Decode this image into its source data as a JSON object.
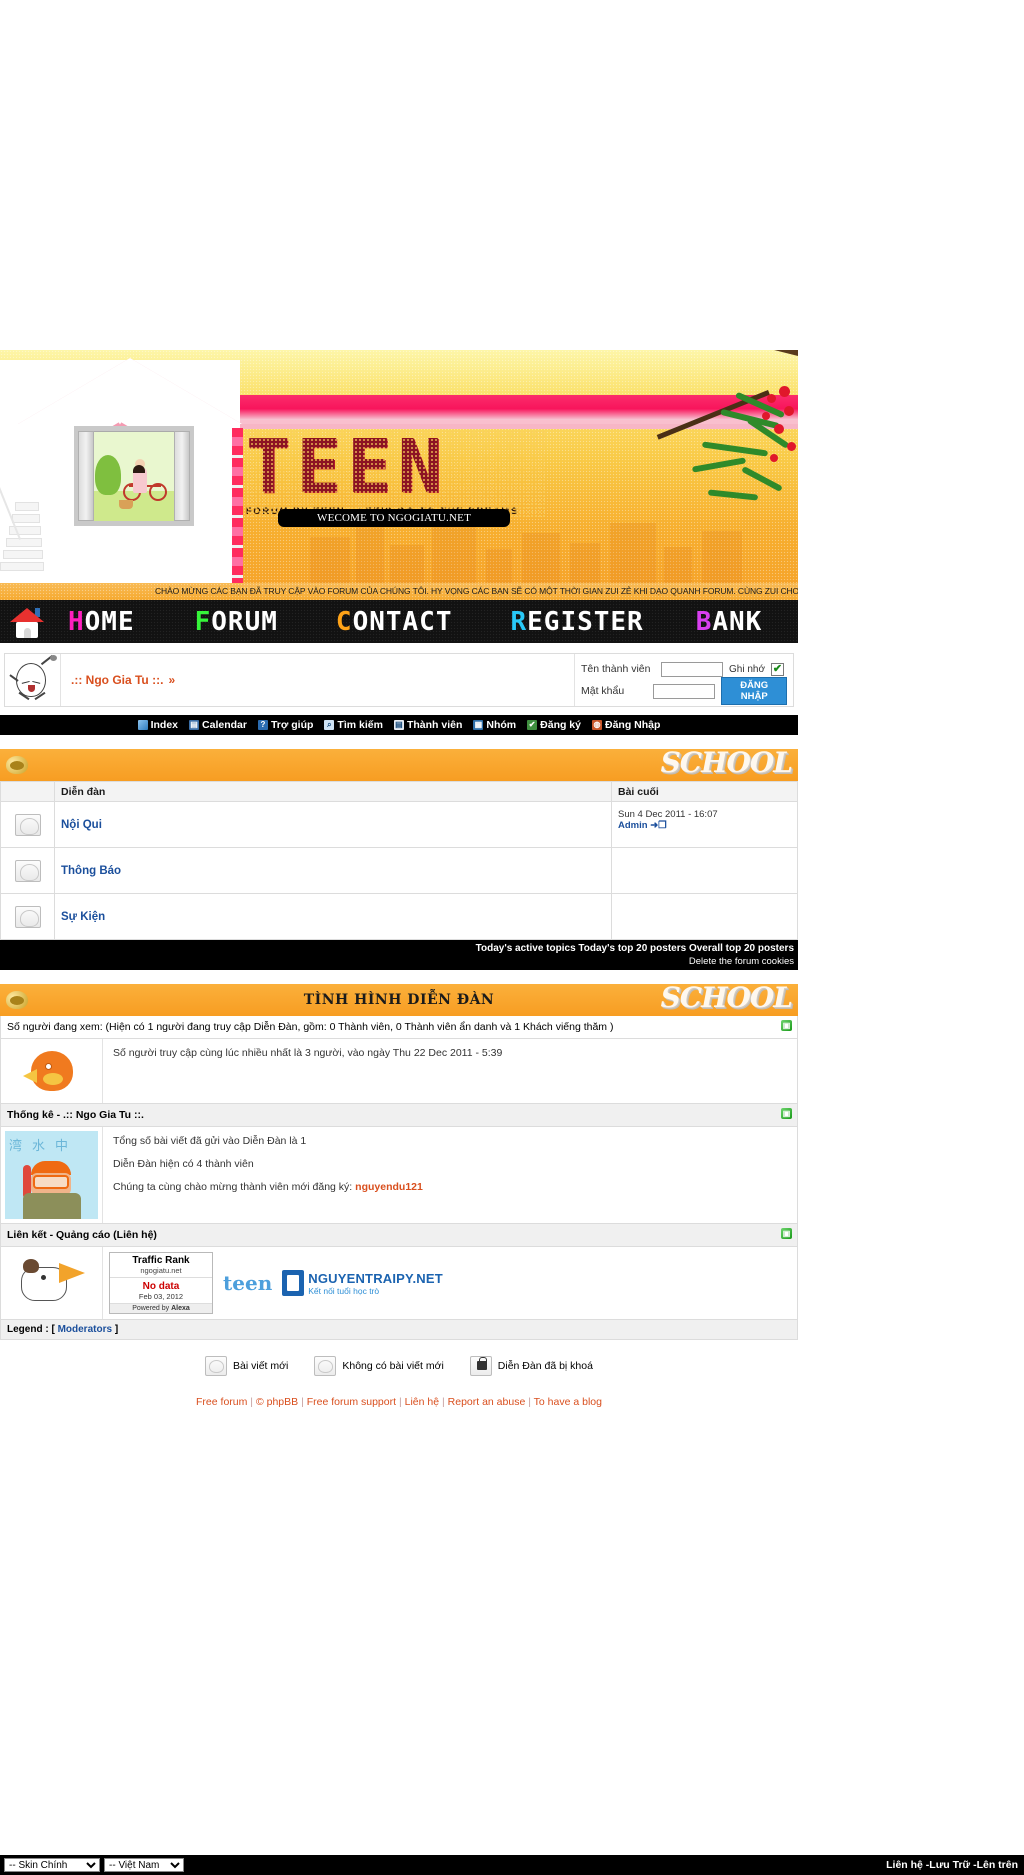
{
  "banner": {
    "logo_text": "TEEN",
    "logo_subtitle": "FORUM BY TEEN - LET'S GO TO THE DREAMS",
    "welcome_pill": "WECOME TO NGOGIATU.NET",
    "marquee": "CHÀO MỪNG CÁC BẠN ĐÃ TRUY CẬP VÀO FORUM CỦA CHÚNG TÔI. HY VỌNG CÁC BẠN SẼ CÓ MỘT THỜI GIAN ZUI ZẺ KHI DẠO QUANH FORUM. CÙNG ZUI CHƠI NHÉ. GOOD LUCK!"
  },
  "mainnav": {
    "home_icon": "house-icon",
    "items": [
      {
        "label": "HOME",
        "color": "#ff1fbf"
      },
      {
        "label": "FORUM",
        "color": "#36f53a"
      },
      {
        "label": "CONTACT",
        "color": "#ffa318"
      },
      {
        "label": "REGISTER",
        "color": "#29c8f7"
      },
      {
        "label": "BANK",
        "color": "#d93ff0"
      }
    ]
  },
  "userbar": {
    "avatar_icon": "egg-mascot-avatar",
    "site_title": ".:: Ngo Gia Tu ::.",
    "site_title_arrow": "»",
    "login": {
      "username_label": "Tên thành viên",
      "username_value": "",
      "password_label": "Mật khẩu",
      "password_value": "",
      "remember_label": "Ghi nhớ",
      "remember_checked": "✔",
      "submit_label": "ĐĂNG NHẬP"
    }
  },
  "subnav": {
    "items": [
      {
        "label": "Index",
        "icon": "index-icon",
        "icon_glyph": ""
      },
      {
        "label": "Calendar",
        "icon": "calendar-icon",
        "icon_glyph": "▤"
      },
      {
        "label": "Trợ giúp",
        "icon": "help-icon",
        "icon_glyph": "?"
      },
      {
        "label": "Tìm kiếm",
        "icon": "search-icon",
        "icon_glyph": "⌕"
      },
      {
        "label": "Thành viên",
        "icon": "members-icon",
        "icon_glyph": "▤"
      },
      {
        "label": "Nhóm",
        "icon": "groups-icon",
        "icon_glyph": "▦"
      },
      {
        "label": "Đăng ký",
        "icon": "register-icon",
        "icon_glyph": "✔"
      },
      {
        "label": "Đăng Nhập",
        "icon": "login-icon",
        "icon_glyph": "◍"
      }
    ]
  },
  "forum_table": {
    "header_watermark": "SCHOOL",
    "header_title": "",
    "columns": [
      "Diễn đàn",
      "Bài cuối"
    ],
    "rows": [
      {
        "icon": "forum-folder-icon",
        "name": "Nội Qui",
        "last_post_date": "Sun 4 Dec 2011 - 16:07",
        "last_post_author": "Admin",
        "last_post_jump": "➜❐"
      },
      {
        "icon": "forum-folder-icon",
        "name": "Thông Báo",
        "last_post_date": "",
        "last_post_author": "",
        "last_post_jump": ""
      },
      {
        "icon": "forum-folder-icon",
        "name": "Sự Kiện",
        "last_post_date": "",
        "last_post_author": "",
        "last_post_jump": ""
      }
    ],
    "footer_line1": "Today's active topics Today's top 20 posters Overall top 20 posters",
    "footer_line2": "Delete the forum cookies"
  },
  "stats": {
    "header_title": "TÌNH HÌNH DIỄN ĐÀN",
    "header_watermark": "SCHOOL",
    "viewing_line": "Số người đang xem: (Hiện có 1 người đang truy cập Diễn Đàn, gồm: 0 Thành viên, 0 Thành viên ẩn danh và 1 Khách viếng thăm )",
    "record_line": "Số người truy cập cùng lúc nhiều nhất là 3 người, vào ngày Thu 22 Dec 2011 - 5:39",
    "record_icon": "bird-mascot-icon",
    "stats_header": "Thống kê - .:: Ngo Gia Tu ::.",
    "stats_icon": "diver-mascot-icon",
    "total_posts": "Tổng số bài viết đã gửi vào Diễn Đàn là 1",
    "total_members": "Diễn Đàn hiện có 4 thành viên",
    "newest_member_prefix": "Chúng ta cùng chào mừng thành viên mới đăng ký:",
    "newest_member": "nguyendu121",
    "links_header": "Liên kết - Quảng cáo (Liên hệ)",
    "links_icon": "megaphone-dog-icon",
    "collapse_glyph": "▣"
  },
  "ads": {
    "alexa": {
      "title": "Traffic Rank",
      "domain": "ngogiatu.net",
      "value": "No data",
      "date": "Feb 03, 2012",
      "powered": "Powered by",
      "brand": "Alexa"
    },
    "teen_logo": "teen",
    "partner": {
      "name": "NGUYENTRAIPY.NET",
      "tagline": "Kết nối tuổi học trò",
      "icon": "book-icon"
    }
  },
  "legend": {
    "prefix": "Legend :",
    "bracket_open": "[",
    "moderators": "Moderators",
    "bracket_close": "]",
    "icons": [
      {
        "label": "Bài viết mới",
        "icon": "new-posts-folder-icon"
      },
      {
        "label": "Không có bài viết mới",
        "icon": "no-new-posts-folder-icon"
      },
      {
        "label": "Diễn Đàn đã bị khoá",
        "icon": "locked-forum-icon"
      }
    ]
  },
  "footer": {
    "links": [
      "Free forum",
      "phpBB",
      "Free forum support",
      "Liên hệ",
      "Report an abuse",
      "To have a blog"
    ],
    "copy_glyph": "©"
  },
  "bottombar": {
    "skin_select": "-- Skin Chính",
    "lang_select": "-- Việt Nam",
    "right_text": "Liên hệ -Lưu Trữ -Lên trên"
  }
}
